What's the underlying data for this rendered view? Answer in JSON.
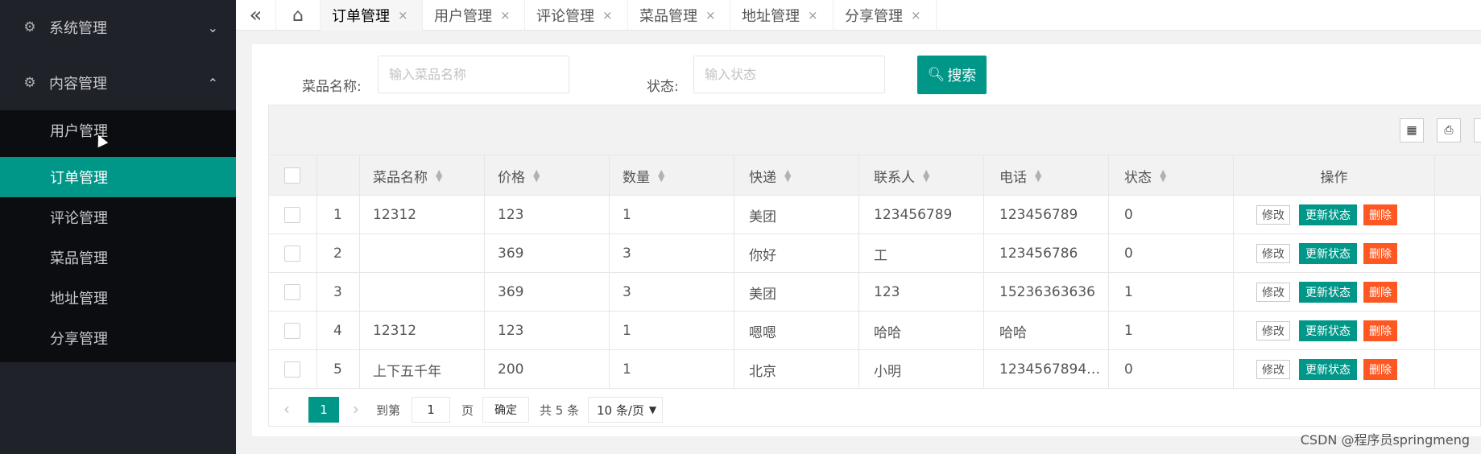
{
  "sidebar": {
    "groups": [
      {
        "label": "系统管理",
        "icon": "gear-icon",
        "chevron": "⌄"
      },
      {
        "label": "内容管理",
        "icon": "gear-icon",
        "chevron": "⌃"
      }
    ],
    "items": [
      {
        "label": "用户管理"
      },
      {
        "label": "订单管理"
      },
      {
        "label": "评论管理"
      },
      {
        "label": "菜品管理"
      },
      {
        "label": "地址管理"
      },
      {
        "label": "分享管理"
      }
    ],
    "active_item": "订单管理"
  },
  "tabbar": {
    "back_icon": "«",
    "home_icon": "⌂",
    "tabs": [
      {
        "label": "订单管理",
        "close": "×"
      },
      {
        "label": "用户管理",
        "close": "×"
      },
      {
        "label": "评论管理",
        "close": "×"
      },
      {
        "label": "菜品管理",
        "close": "×"
      },
      {
        "label": "地址管理",
        "close": "×"
      },
      {
        "label": "分享管理",
        "close": "×"
      }
    ],
    "active_tab": "订单管理"
  },
  "search": {
    "name_label": "菜品名称:",
    "name_placeholder": "输入菜品名称",
    "status_label": "状态:",
    "status_placeholder": "输入状态",
    "button_label": "搜索"
  },
  "table": {
    "columns": [
      "菜品名称",
      "价格",
      "数量",
      "快递",
      "联系人",
      "电话",
      "状态",
      "操作"
    ],
    "rows": [
      {
        "id": "1",
        "name": "12312",
        "price": "123",
        "qty": "1",
        "courier": "美团",
        "contact": "123456789",
        "phone": "123456789",
        "status": "0"
      },
      {
        "id": "2",
        "name": "",
        "price": "369",
        "qty": "3",
        "courier": "你好",
        "contact": "工",
        "phone": "123456786",
        "status": "0"
      },
      {
        "id": "3",
        "name": "",
        "price": "369",
        "qty": "3",
        "courier": "美团",
        "contact": "123",
        "phone": "15236363636",
        "status": "1"
      },
      {
        "id": "4",
        "name": "12312",
        "price": "123",
        "qty": "1",
        "courier": "嗯嗯",
        "contact": "哈哈",
        "phone": "哈哈",
        "status": "1"
      },
      {
        "id": "5",
        "name": "上下五千年",
        "price": "200",
        "qty": "1",
        "courier": "北京",
        "contact": "小明",
        "phone": "1234567894…",
        "status": "0"
      }
    ],
    "actions": {
      "edit": "修改",
      "update_status": "更新状态",
      "delete": "删除"
    }
  },
  "pagination": {
    "prev": "‹",
    "current": "1",
    "next": "›",
    "goto_label": "到第",
    "goto_value": "1",
    "page_unit": "页",
    "confirm": "确定",
    "total": "共 5 条",
    "page_size": "10 条/页"
  },
  "watermark": "CSDN @程序员springmeng",
  "colors": {
    "accent": "#009688",
    "danger": "#ff5722",
    "sidebar_bg": "#20222a"
  }
}
